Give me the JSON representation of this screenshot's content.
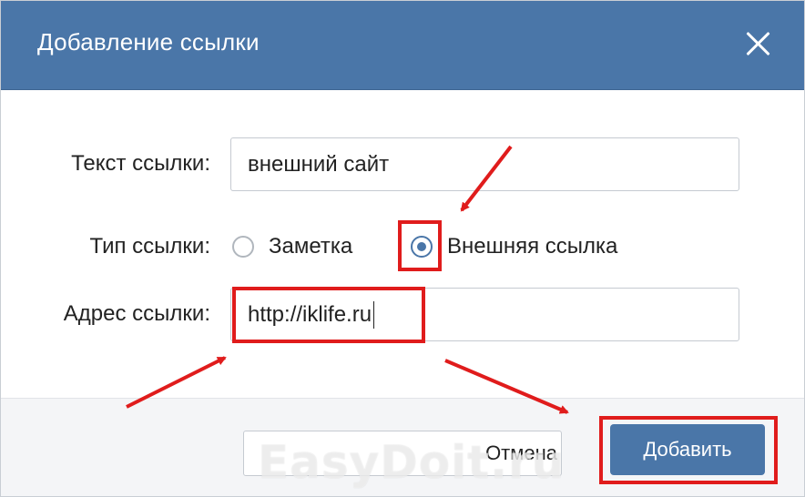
{
  "dialog": {
    "title": "Добавление ссылки",
    "close_icon": "close-icon"
  },
  "form": {
    "link_text_label": "Текст ссылки:",
    "link_text_value": "внешний сайт",
    "link_type_label": "Тип ссылки:",
    "link_type_options": [
      {
        "label": "Заметка",
        "selected": false
      },
      {
        "label": "Внешняя ссылка",
        "selected": true
      }
    ],
    "link_address_label": "Адрес ссылки:",
    "link_address_value": "http://iklife.ru"
  },
  "buttons": {
    "cancel": "Отмена",
    "add": "Добавить"
  },
  "watermark": "EasyDoit.ru",
  "colors": {
    "titlebar": "#4a76a8",
    "primary_button": "#4a76a8",
    "highlight": "#e01c1c"
  }
}
